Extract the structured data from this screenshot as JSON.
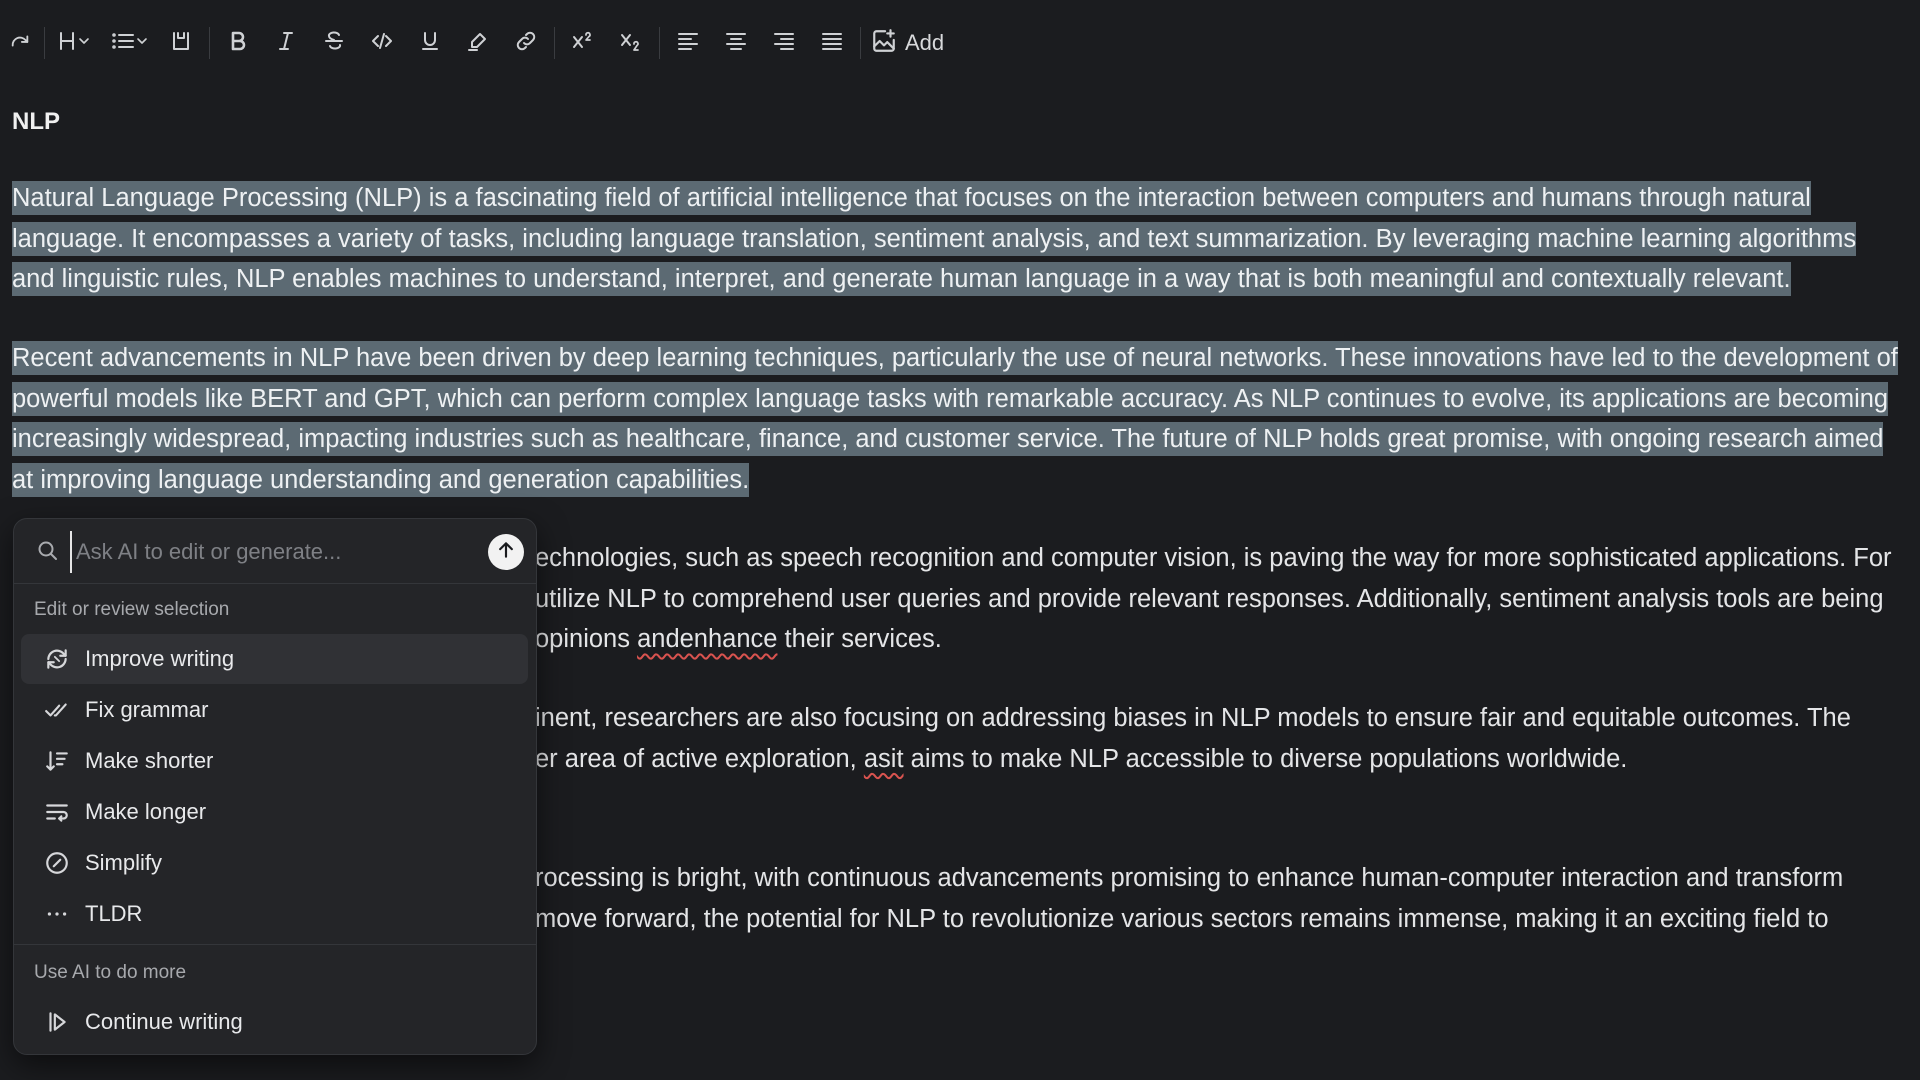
{
  "toolbar": {
    "add_label": "Add",
    "icons": [
      "redo-icon",
      "heading-icon",
      "list-icon",
      "block-icon",
      "bold-icon",
      "italic-icon",
      "strikethrough-icon",
      "code-icon",
      "underline-icon",
      "highlight-icon",
      "link-icon",
      "superscript-icon",
      "subscript-icon",
      "align-left-icon",
      "align-center-icon",
      "align-right-icon",
      "align-justify-icon",
      "add-image-icon"
    ]
  },
  "document": {
    "title": "NLP",
    "p1": [
      "Natural Language Processing (NLP) is a fascinating field of artificial intelligence that focuses on the interaction between computers and humans through natural",
      "language. It encompasses a variety of tasks, including language translation, sentiment analysis, and text summarization. By leveraging machine learning algorithms",
      "and linguistic rules, NLP enables machines to understand, interpret, and generate human language in a way that is both meaningful and contextually relevant."
    ],
    "p2": [
      "Recent advancements in NLP have been driven by deep learning techniques, particularly the use of neural networks. These innovations have led to the development of",
      "powerful models like BERT and GPT, which can perform complex language tasks with remarkable accuracy. As NLP continues to evolve, its applications are becoming",
      "increasingly widespread, impacting industries such as healthcare, finance, and customer service. The future of NLP holds great promise, with ongoing research aimed",
      "at improving language understanding and generation capabilities."
    ],
    "p3": {
      "l1": "echnologies, such as speech recognition and computer vision, is paving the way for more sophisticated applications. For",
      "l2": "utilize NLP to comprehend user queries and provide relevant responses. Additionally, sentiment analysis tools are being",
      "l3_a": "opinions ",
      "l3_err": "andenhance",
      "l3_b": " their services."
    },
    "p4": {
      "l1": "inent, researchers are also focusing on addressing biases in NLP models to ensure fair and equitable outcomes. The",
      "l2_a": "er area of active exploration, ",
      "l2_err": "asit",
      "l2_b": " aims to make NLP accessible to diverse populations worldwide."
    },
    "p5": {
      "l1": "rocessing is bright, with continuous advancements promising to enhance human-computer interaction and transform",
      "l2": " move forward, the potential for NLP to revolutionize various sectors remains immense, making it an exciting field to"
    }
  },
  "ai_panel": {
    "input_placeholder": "Ask AI to edit or generate...",
    "input_value": "",
    "section_edit": "Edit or review selection",
    "section_more": "Use AI to do more",
    "items": [
      {
        "label": "Improve writing",
        "icon": "improve-writing-icon"
      },
      {
        "label": "Fix grammar",
        "icon": "fix-grammar-icon"
      },
      {
        "label": "Make shorter",
        "icon": "make-shorter-icon"
      },
      {
        "label": "Make longer",
        "icon": "make-longer-icon"
      },
      {
        "label": "Simplify",
        "icon": "simplify-icon"
      },
      {
        "label": "TLDR",
        "icon": "tldr-icon"
      }
    ],
    "more_items": [
      {
        "label": "Continue writing",
        "icon": "continue-writing-icon"
      }
    ]
  },
  "colors": {
    "background": "#1b1c1f",
    "selection": "#5c6a73",
    "panel": "#242528",
    "panel_active_item": "#303135"
  }
}
